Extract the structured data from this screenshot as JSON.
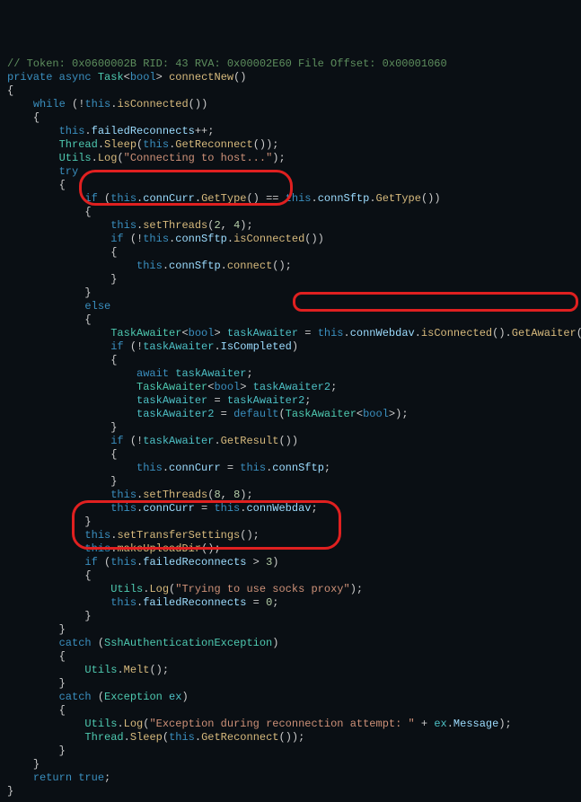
{
  "comment": "// Token: 0x0600002B RID: 43 RVA: 0x00002E60 File Offset: 0x00001060",
  "sig": {
    "kw_private": "private",
    "kw_async": "async",
    "type_Task": "Task",
    "type_bool": "bool",
    "method": "connectNew"
  },
  "kw": {
    "while": "while",
    "this": "this",
    "try": "try",
    "if": "if",
    "else": "else",
    "await": "await",
    "default": "default",
    "catch": "catch",
    "return": "return",
    "true": "true"
  },
  "mem": {
    "isConnected": "isConnected",
    "failedReconnects": "failedReconnects",
    "Thread": "Thread",
    "Sleep": "Sleep",
    "GetReconnect": "GetReconnect",
    "Utils": "Utils",
    "Log": "Log",
    "connCurr": "connCurr",
    "GetType": "GetType",
    "connSftp": "connSftp",
    "setThreads": "setThreads",
    "connect": "connect",
    "TaskAwaiter": "TaskAwaiter",
    "taskAwaiter": "taskAwaiter",
    "taskAwaiter2": "taskAwaiter2",
    "connWebdav": "connWebdav",
    "GetAwaiter": "GetAwaiter",
    "IsCompleted": "IsCompleted",
    "GetResult": "GetResult",
    "setTransferSettings": "setTransferSettings",
    "makeUploadDir": "makeUploadDir",
    "Melt": "Melt",
    "SshAuthenticationException": "SshAuthenticationException",
    "Exception": "Exception",
    "ex": "ex",
    "Message": "Message"
  },
  "str": {
    "connecting": "\"Connecting to host...\"",
    "trying_proxy": "\"Trying to use socks proxy\"",
    "exception_msg": "\"Exception during reconnection attempt: \""
  },
  "num": {
    "n2": "2",
    "n4": "4",
    "n8a": "8",
    "n8b": "8",
    "n3": "3",
    "n0": "0"
  }
}
